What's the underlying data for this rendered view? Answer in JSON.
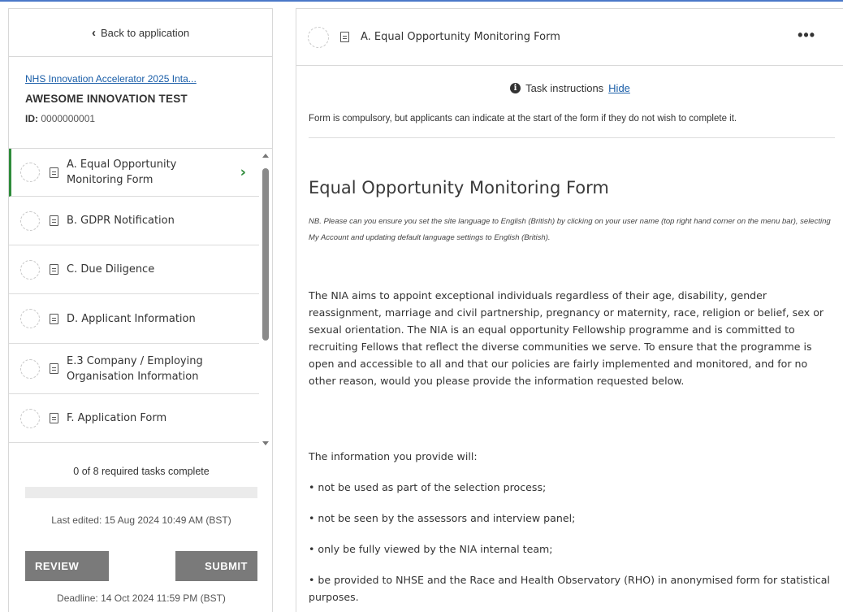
{
  "sidebar": {
    "back_label": "Back to application",
    "application_link": "NHS Innovation Accelerator 2025 Inta...",
    "application_name": "AWESOME INNOVATION TEST",
    "id_label": "ID:",
    "id_value": "0000000001",
    "tasks": [
      {
        "label": "A. Equal Opportunity Monitoring Form",
        "active": true
      },
      {
        "label": "B. GDPR Notification",
        "active": false
      },
      {
        "label": "C. Due Diligence",
        "active": false
      },
      {
        "label": "D. Applicant Information",
        "active": false
      },
      {
        "label": "E.3 Company / Employing Organisation Information",
        "active": false
      },
      {
        "label": "F. Application Form",
        "active": false
      }
    ],
    "progress_text": "0 of 8 required tasks complete",
    "progress_fraction": 0,
    "last_edited": "Last edited: 15 Aug 2024 10:49 AM (BST)",
    "review_label": "REVIEW",
    "submit_label": "SUBMIT",
    "deadline": "Deadline: 14 Oct 2024 11:59 PM (BST)"
  },
  "main": {
    "header_title": "A. Equal Opportunity Monitoring Form",
    "more_label": "•••",
    "instructions_label": "Task instructions",
    "hide_label": "Hide",
    "instructions_text": "Form is compulsory, but applicants can indicate at the start of the form if they do not wish to complete it.",
    "form_title": "Equal Opportunity Monitoring Form",
    "form_note": "NB. Please can you ensure you set the site language to English (British) by clicking on your user name (top right hand corner on the menu bar), selecting My Account and updating default language settings to English (British).",
    "paragraph_1": "The NIA aims to appoint exceptional individuals regardless of their age, disability, gender reassignment, marriage and civil partnership, pregnancy or maternity, race, religion or belief, sex or sexual orientation. The NIA is an equal opportunity Fellowship programme and is committed to recruiting Fellows that reflect the diverse communities we serve. To ensure that the programme is open and accessible to all and that our policies are fairly implemented and monitored, and for no other reason, would you please provide the information requested below.",
    "paragraph_2": "The information you provide will:",
    "bullets": [
      "• not be used as part of the selection process;",
      "• not be seen by the assessors and interview panel;",
      "• only be fully viewed by the NIA internal team;",
      "• be provided to NHSE and the Race and Health Observatory (RHO) in anonymised form for statistical purposes."
    ]
  },
  "colors": {
    "accent_green": "#2e8b3a",
    "link_blue": "#1a5ea8",
    "button_grey": "#7a7a7a"
  }
}
